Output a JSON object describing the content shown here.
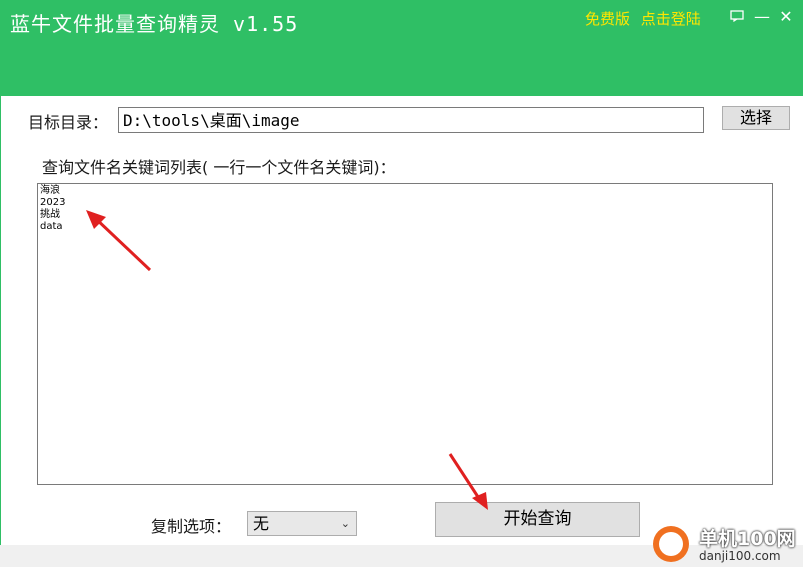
{
  "window": {
    "title": "蓝牛文件批量查询精灵 v1.55",
    "free_label": "免费版",
    "login_label": "点击登陆",
    "feedback_icon": "chat-bubble-icon",
    "minimize_symbol": "—",
    "close_symbol": "✕",
    "accent_color": "#2fbf65",
    "link_color": "#ffe600"
  },
  "form": {
    "dir_label": "目标目录：",
    "dir_value": "D:\\tools\\桌面\\image",
    "choose_button": "选择",
    "keywords_label": "查询文件名关键词列表( 一行一个文件名关键词)：",
    "keywords": [
      "海浪",
      "2023",
      "挑战",
      "data"
    ],
    "copy_label": "复制选项：",
    "copy_option": "无",
    "start_button": "开始查询"
  },
  "watermark": {
    "site_name": "单机100网",
    "site_url": "danji100.com"
  }
}
